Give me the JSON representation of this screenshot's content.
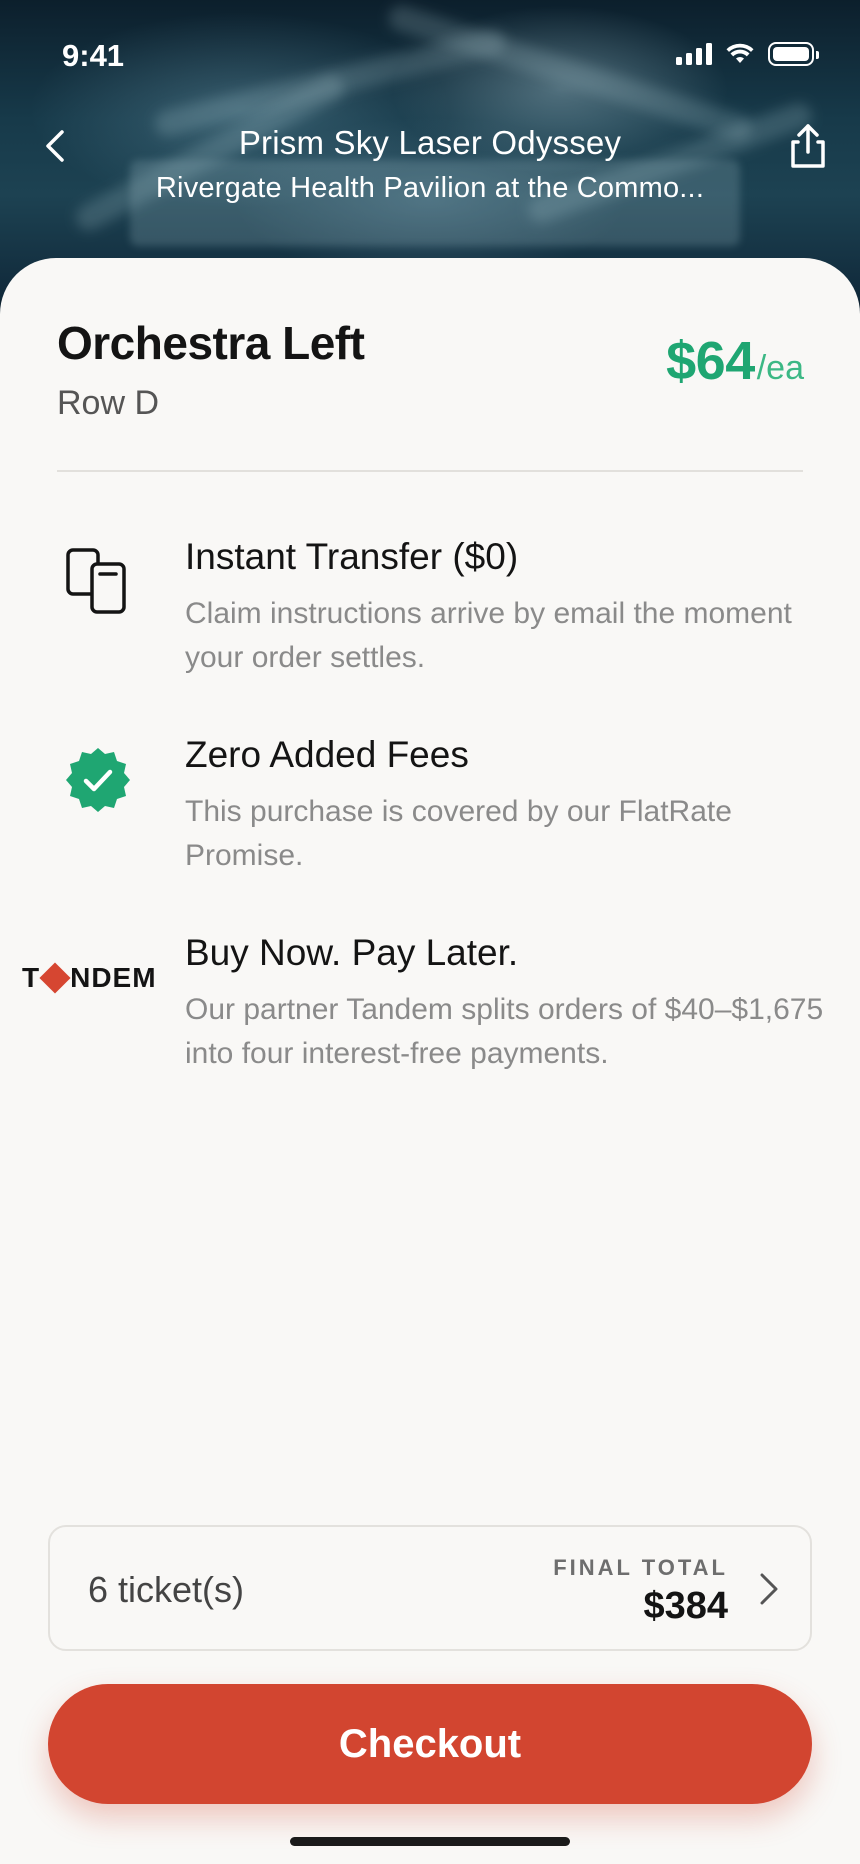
{
  "status_bar": {
    "time": "9:41"
  },
  "header": {
    "event_title": "Prism Sky Laser Odyssey",
    "venue": "Rivergate Health Pavilion at the Commo..."
  },
  "listing": {
    "section": "Orchestra Left",
    "row": "Row D",
    "price": "$64",
    "price_unit": "/ea"
  },
  "features": [
    {
      "icon": "phone-transfer-icon",
      "title": "Instant Transfer ($0)",
      "description": "Claim instructions arrive by email the moment your order settles."
    },
    {
      "icon": "verified-badge-icon",
      "title": "Zero Added Fees",
      "description": "This purchase is covered by our FlatRate Promise."
    },
    {
      "icon": "tandem-logo",
      "title": "Buy Now. Pay Later.",
      "description": "Our partner Tandem splits orders of $40–$1,675 into four interest-free payments."
    }
  ],
  "tandem_logo": {
    "left": "T",
    "right": "NDEM"
  },
  "summary": {
    "tickets": "6 ticket(s)",
    "total_label": "FINAL TOTAL",
    "total_amount": "$384"
  },
  "checkout_label": "Checkout",
  "colors": {
    "accent_green": "#1fa672",
    "checkout_red": "#d24530",
    "badge_green": "#1fa672"
  }
}
